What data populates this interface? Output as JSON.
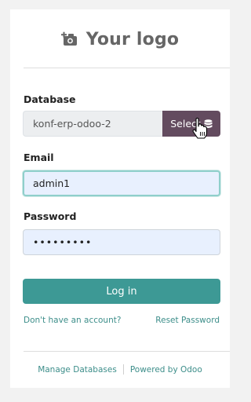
{
  "logo": {
    "text": "Your logo",
    "icon": "camera-plus-icon"
  },
  "database": {
    "label": "Database",
    "value": "konf-erp-odoo-2",
    "button_label": "Select",
    "button_icon": "database-icon"
  },
  "email": {
    "label": "Email",
    "value": "admin1"
  },
  "password": {
    "label": "Password",
    "value": "•••••••••"
  },
  "login_button": "Log in",
  "links": {
    "signup": "Don't have an account?",
    "reset": "Reset Password"
  },
  "footer": {
    "manage": "Manage Databases",
    "powered": "Powered by Odoo"
  },
  "colors": {
    "primary": "#3d9995",
    "select_button": "#634b5f",
    "link": "#3d8e8a"
  }
}
